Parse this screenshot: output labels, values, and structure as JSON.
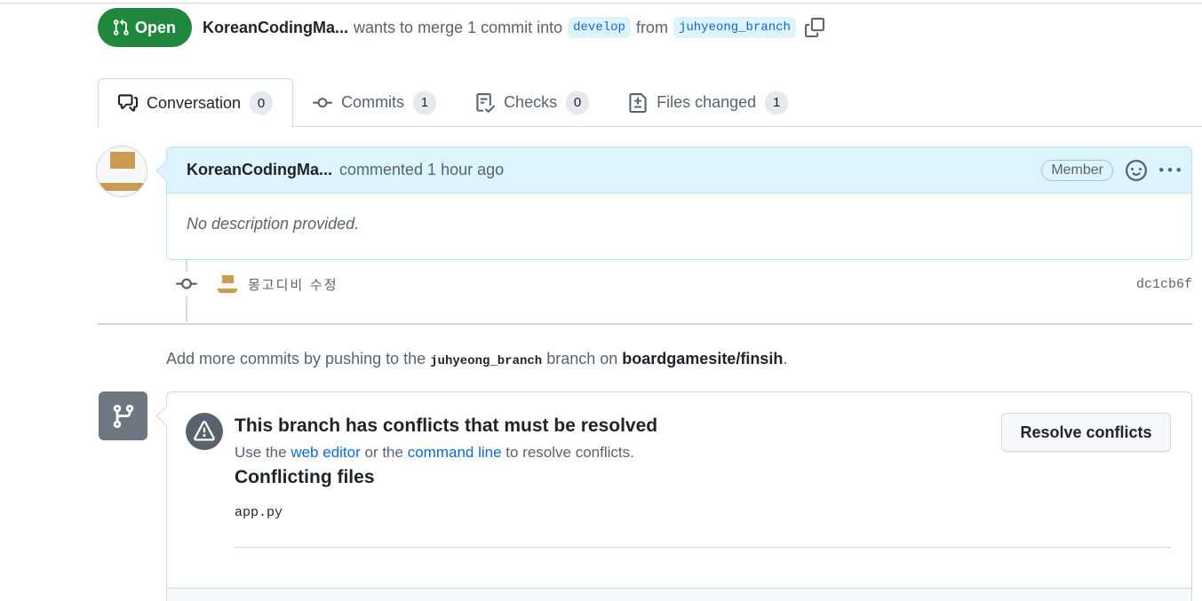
{
  "header": {
    "state_label": "Open",
    "author": "KoreanCodingMa...",
    "merge_text_1": "wants to merge 1 commit into",
    "base_branch": "develop",
    "merge_text_2": "from",
    "head_branch": "juhyeong_branch"
  },
  "tabs": [
    {
      "label": "Conversation",
      "count": "0",
      "icon": "comment-discussion-icon"
    },
    {
      "label": "Commits",
      "count": "1",
      "icon": "git-commit-icon"
    },
    {
      "label": "Checks",
      "count": "0",
      "icon": "checklist-icon"
    },
    {
      "label": "Files changed",
      "count": "1",
      "icon": "file-diff-icon"
    }
  ],
  "comment": {
    "author": "KoreanCodingMa...",
    "action": "commented 1 hour ago",
    "role_badge": "Member",
    "body": "No description provided."
  },
  "commit": {
    "message": "몽고디비 수정",
    "sha": "dc1cb6f"
  },
  "push_note": {
    "prefix": "Add more commits by pushing to the",
    "branch": "juhyeong_branch",
    "middle": "branch on",
    "repo": "boardgamesite/finsih",
    "suffix": "."
  },
  "merge_box": {
    "title": "This branch has conflicts that must be resolved",
    "sub_prefix": "Use the",
    "link_web_editor": "web editor",
    "sub_middle": "or the",
    "link_command_line": "command line",
    "sub_suffix": "to resolve conflicts.",
    "files_title": "Conflicting files",
    "files": [
      "app.py"
    ],
    "resolve_button": "Resolve conflicts"
  },
  "colors": {
    "open_green": "#1f883d",
    "link_blue": "#0969da",
    "comment_header_bg": "#ddf4ff",
    "avatar_gold": "#c99c52"
  }
}
